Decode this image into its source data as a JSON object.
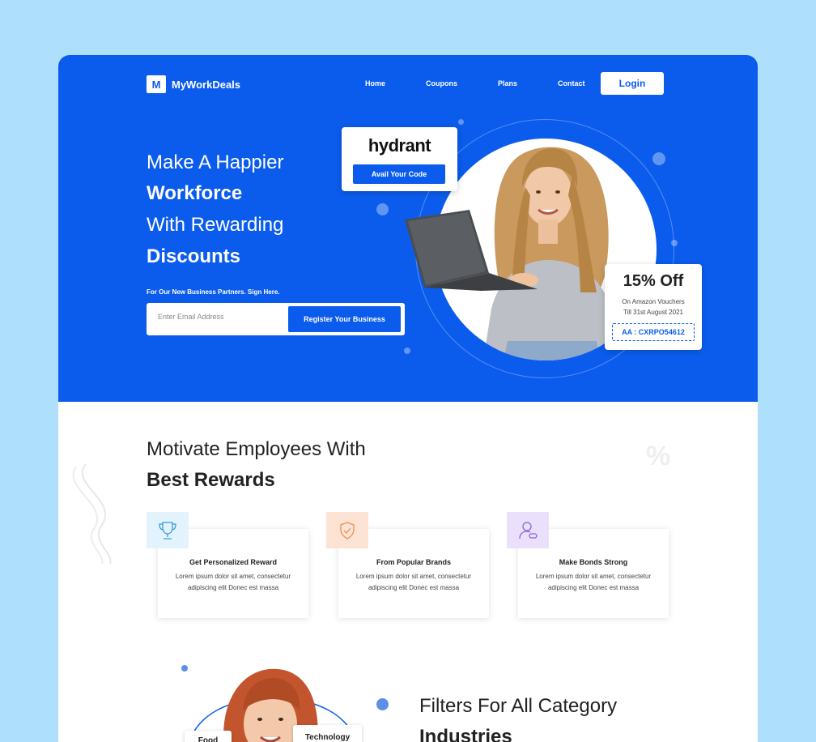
{
  "header": {
    "brand": "MyWorkDeals",
    "brand_mark": "M",
    "nav": [
      "Home",
      "Coupons",
      "Plans",
      "Contact"
    ],
    "login": "Login"
  },
  "hero": {
    "line1": "Make A Happier",
    "line2": "Workforce",
    "line3": "With Rewarding",
    "line4": "Discounts",
    "partners_text": "For Our New Business Partners. Sign Here.",
    "email_placeholder": "Enter Email Address",
    "register_button": "Register Your Business"
  },
  "promo_card": {
    "brand": "hydrant",
    "button": "Avail Your Code"
  },
  "offer_card": {
    "title": "15% Off",
    "desc_line1": "On Amazon Vouchers",
    "desc_line2": "Till 31st August 2021",
    "code": "AA : CXRPO54612"
  },
  "rewards_section": {
    "title_line1": "Motivate Employees With",
    "title_line2": "Best Rewards",
    "features": [
      {
        "title": "Get Personalized Reward",
        "desc": "Lorem ipsum dolor sit amet, consectetur adipiscing elit Donec est massa",
        "icon": "trophy-icon"
      },
      {
        "title": "From Popular Brands",
        "desc": "Lorem ipsum dolor sit amet, consectetur adipiscing elit Donec est massa",
        "icon": "shield-check-icon"
      },
      {
        "title": "Make Bonds Strong",
        "desc": "Lorem ipsum dolor sit amet, consectetur adipiscing elit Donec est massa",
        "icon": "user-link-icon"
      }
    ]
  },
  "filters_section": {
    "title_line1": "Filters For All Category",
    "title_line2": "Industries",
    "chips": [
      "Food",
      "Technology"
    ]
  },
  "colors": {
    "primary": "#0b5ced",
    "page_bg": "#aee0fd",
    "icon_blue_bg": "#e3f3fd",
    "icon_orange_bg": "#fde3d3",
    "icon_purple_bg": "#ebe0fb"
  }
}
